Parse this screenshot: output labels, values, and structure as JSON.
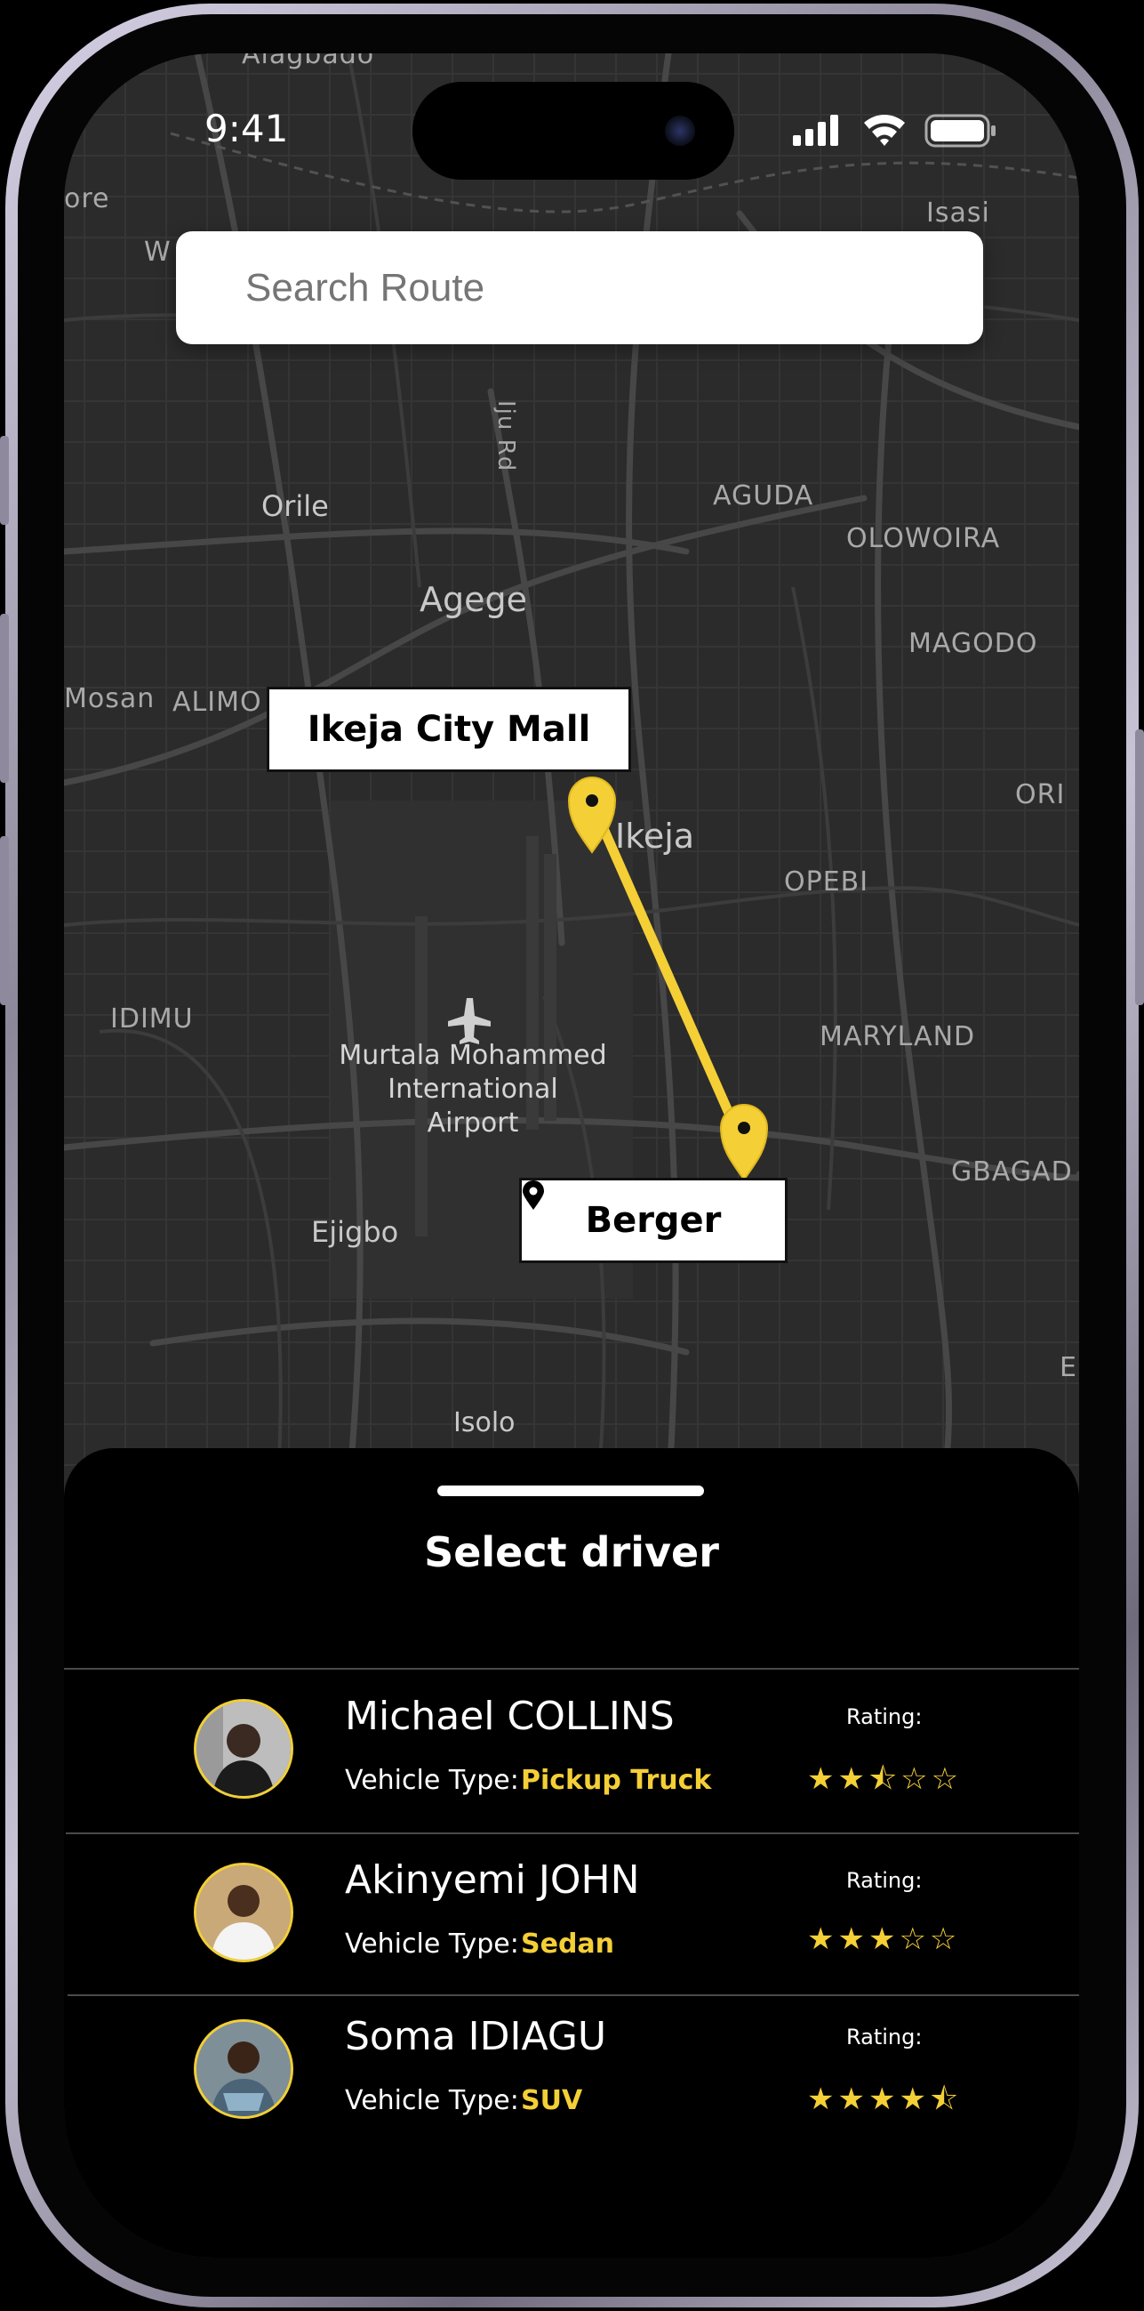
{
  "status_bar": {
    "time": "9:41"
  },
  "search": {
    "placeholder": "Search Route"
  },
  "map": {
    "labels": {
      "alagbado": "Alagbado",
      "ore": "ore",
      "w": "W",
      "isasi": "Isasi",
      "iju_rd": "Iju Rd",
      "orile": "Orile",
      "aguda": "AGUDA",
      "olowoira": "OLOWOIRA",
      "agege": "Agege",
      "magodo": "MAGODO",
      "mosan": "Mosan",
      "alimo": "ALIMO",
      "ikeja": "Ikeja",
      "ori": "ORI",
      "opebi": "OPEBI",
      "idimu": "IDIMU",
      "maryland": "MARYLAND",
      "airport_1": "Murtala Mohammed",
      "airport_2": "International",
      "airport_3": "Airport",
      "gbagad": "GBAGAD",
      "ejigbo": "Ejigbo",
      "e": "E",
      "isolo": "Isolo"
    },
    "origin_label": "Ikeja City Mall",
    "destination_label": "Berger",
    "route_color": "#f4cf36"
  },
  "sheet": {
    "title": "Select driver",
    "drivers": [
      {
        "name": "Michael COLLINS",
        "vehicle_label": "Vehicle Type:",
        "vehicle_type": "Pickup Truck",
        "rating_label": "Rating:",
        "rating": 2.5,
        "stars": "★★⯪☆☆"
      },
      {
        "name": "Akinyemi JOHN",
        "vehicle_label": "Vehicle Type:",
        "vehicle_type": "Sedan",
        "rating_label": "Rating:",
        "rating": 3,
        "stars": "★★★☆☆"
      },
      {
        "name": "Soma IDIAGU",
        "vehicle_label": "Vehicle Type:",
        "vehicle_type": "SUV",
        "rating_label": "Rating:",
        "rating": 4.5,
        "stars": "★★★★⯪"
      }
    ]
  },
  "colors": {
    "accent": "#f4cf36",
    "sheet_bg": "#000000",
    "map_bg": "#2b2b2b"
  }
}
